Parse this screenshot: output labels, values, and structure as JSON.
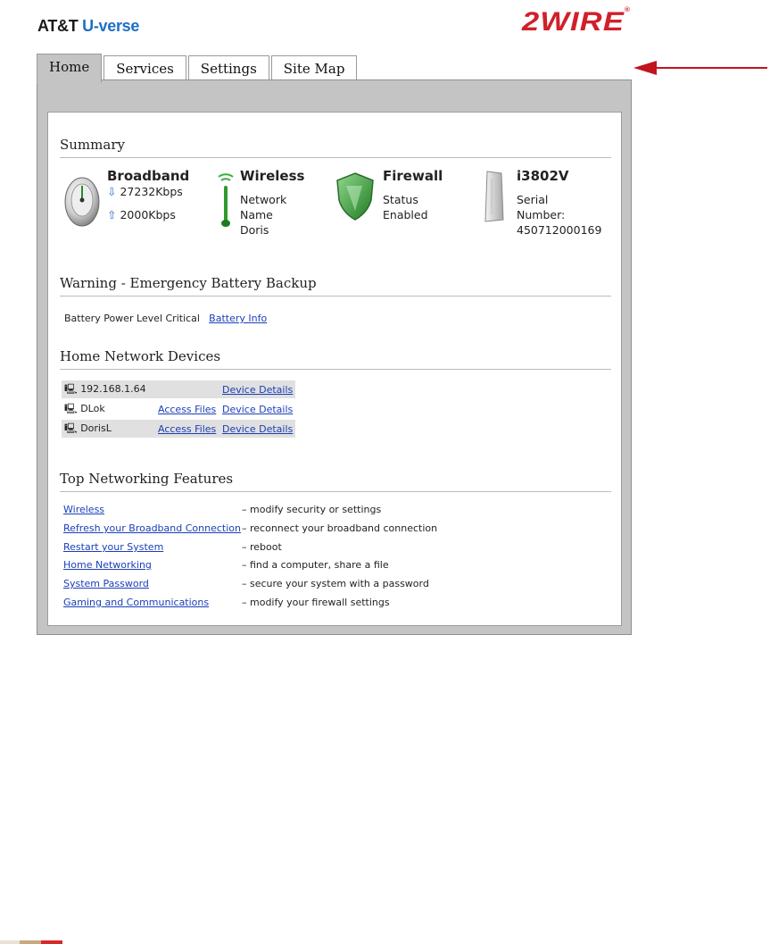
{
  "header": {
    "brand_main": "AT&T ",
    "brand_u": "U-verse",
    "partner_logo": "2WIRE",
    "partner_reg": "®"
  },
  "tabs": [
    {
      "label": "Home",
      "active": true
    },
    {
      "label": "Services",
      "active": false
    },
    {
      "label": "Settings",
      "active": false
    },
    {
      "label": "Site Map",
      "active": false
    }
  ],
  "summary": {
    "title": "Summary",
    "broadband": {
      "title": "Broadband",
      "down": "27232Kbps",
      "up": "2000Kbps",
      "icon": "gauge-icon"
    },
    "wireless": {
      "title": "Wireless",
      "line1": "Network",
      "line2": "Name",
      "line3": "Doris",
      "icon": "antenna-icon"
    },
    "firewall": {
      "title": "Firewall",
      "line1": "Status",
      "line2": "Enabled",
      "icon": "shield-icon"
    },
    "device": {
      "title": "i3802V",
      "line1": "Serial",
      "line2": "Number:",
      "line3": "450712000169",
      "icon": "gateway-device-icon"
    }
  },
  "warning": {
    "title": "Warning - Emergency Battery Backup",
    "message": "Battery Power Level Critical",
    "link": "Battery Info"
  },
  "devices": {
    "title": "Home Network Devices",
    "rows": [
      {
        "name": "192.168.1.64",
        "access": "",
        "details": "Device Details"
      },
      {
        "name": "DLok",
        "access": "Access Files",
        "details": "Device Details"
      },
      {
        "name": "DorisL",
        "access": "Access Files",
        "details": "Device Details"
      }
    ]
  },
  "features": {
    "title": "Top Networking Features",
    "items": [
      {
        "link": "Wireless",
        "desc": "– modify security or settings"
      },
      {
        "link": "Refresh your Broadband Connection",
        "desc": "– reconnect your broadband connection"
      },
      {
        "link": "Restart your System",
        "desc": "– reboot"
      },
      {
        "link": "Home Networking",
        "desc": "– find a computer, share a file"
      },
      {
        "link": "System Password",
        "desc": "– secure your system with a password"
      },
      {
        "link": "Gaming and Communications",
        "desc": "– modify your firewall settings"
      }
    ]
  },
  "colors": {
    "accent_red": "#d21f2b",
    "link_blue": "#1a3fb8",
    "frame_gray": "#c4c4c4"
  }
}
